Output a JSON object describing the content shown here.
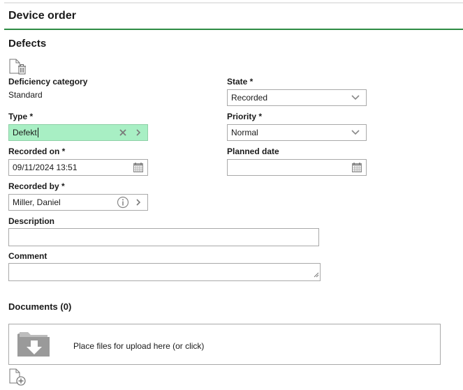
{
  "header": {
    "title": "Device order"
  },
  "section": {
    "title": "Defects"
  },
  "icons": {
    "delete_document": "document-delete-icon",
    "add_document": "document-add-icon",
    "folder_download": "folder-download-icon",
    "calendar": "calendar-icon",
    "info": "info-icon",
    "clear": "close-icon",
    "chevron_right": "chevron-right-icon",
    "chevron_down": "chevron-down-icon"
  },
  "colors": {
    "accent_rule": "#2e8b43",
    "type_field_bg": "#a8efc4"
  },
  "form": {
    "deficiency_category": {
      "label": "Deficiency category",
      "value": "Standard"
    },
    "state": {
      "label": "State *",
      "value": "Recorded"
    },
    "type": {
      "label": "Type *",
      "value": "Defekt"
    },
    "priority": {
      "label": "Priority *",
      "value": "Normal"
    },
    "recorded_on": {
      "label": "Recorded on *",
      "value": "09/11/2024 13:51"
    },
    "planned_date": {
      "label": "Planned date",
      "value": ""
    },
    "recorded_by": {
      "label": "Recorded by *",
      "value": "Miller, Daniel"
    },
    "description": {
      "label": "Description",
      "value": ""
    },
    "comment": {
      "label": "Comment",
      "value": ""
    }
  },
  "documents": {
    "title": "Documents (0)",
    "upload_text": "Place files for upload here (or click)"
  }
}
